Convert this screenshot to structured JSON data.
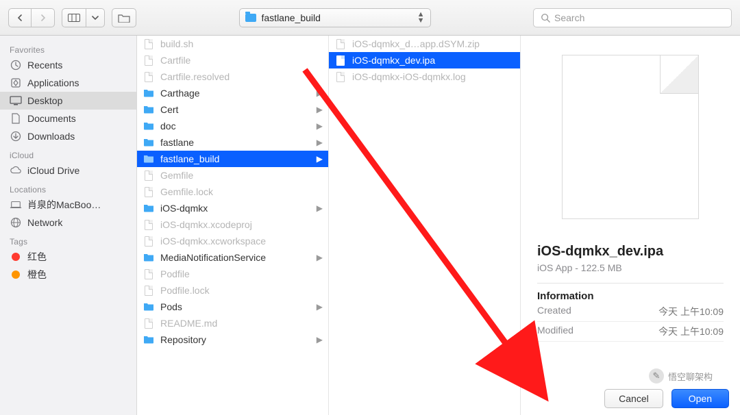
{
  "toolbar": {
    "current_folder": "fastlane_build",
    "search_placeholder": "Search"
  },
  "sidebar": {
    "sections": [
      {
        "title": "Favorites",
        "items": [
          {
            "label": "Recents",
            "icon": "clock"
          },
          {
            "label": "Applications",
            "icon": "app"
          },
          {
            "label": "Desktop",
            "icon": "desktop",
            "selected": true
          },
          {
            "label": "Documents",
            "icon": "doc"
          },
          {
            "label": "Downloads",
            "icon": "download"
          }
        ]
      },
      {
        "title": "iCloud",
        "items": [
          {
            "label": "iCloud Drive",
            "icon": "cloud"
          }
        ]
      },
      {
        "title": "Locations",
        "items": [
          {
            "label": "肖泉的MacBoo…",
            "icon": "laptop"
          },
          {
            "label": "Network",
            "icon": "globe"
          }
        ]
      },
      {
        "title": "Tags",
        "items": [
          {
            "label": "红色",
            "color": "#ff3b30"
          },
          {
            "label": "橙色",
            "color": "#ff9500"
          }
        ]
      }
    ]
  },
  "col1": [
    {
      "name": "build.sh",
      "type": "file",
      "dim": true
    },
    {
      "name": "Cartfile",
      "type": "file",
      "dim": true
    },
    {
      "name": "Cartfile.resolved",
      "type": "file",
      "dim": true
    },
    {
      "name": "Carthage",
      "type": "folder",
      "dim": false
    },
    {
      "name": "Cert",
      "type": "folder",
      "dim": false
    },
    {
      "name": "doc",
      "type": "folder",
      "dim": false
    },
    {
      "name": "fastlane",
      "type": "folder",
      "dim": false
    },
    {
      "name": "fastlane_build",
      "type": "folder",
      "dim": false,
      "selected": true
    },
    {
      "name": "Gemfile",
      "type": "file",
      "dim": true
    },
    {
      "name": "Gemfile.lock",
      "type": "file",
      "dim": true
    },
    {
      "name": "iOS-dqmkx",
      "type": "folder",
      "dim": false
    },
    {
      "name": "iOS-dqmkx.xcodeproj",
      "type": "file",
      "dim": true
    },
    {
      "name": "iOS-dqmkx.xcworkspace",
      "type": "file",
      "dim": true
    },
    {
      "name": "MediaNotificationService",
      "type": "folder",
      "dim": false
    },
    {
      "name": "Podfile",
      "type": "file",
      "dim": true
    },
    {
      "name": "Podfile.lock",
      "type": "file",
      "dim": true
    },
    {
      "name": "Pods",
      "type": "folder",
      "dim": false
    },
    {
      "name": "README.md",
      "type": "file",
      "dim": true
    },
    {
      "name": "Repository",
      "type": "folder",
      "dim": false
    }
  ],
  "col2": [
    {
      "name": "iOS-dqmkx_d…app.dSYM.zip",
      "type": "file",
      "dim": true
    },
    {
      "name": "iOS-dqmkx_dev.ipa",
      "type": "file",
      "dim": false,
      "selected": true
    },
    {
      "name": "iOS-dqmkx-iOS-dqmkx.log",
      "type": "file",
      "dim": true
    }
  ],
  "preview": {
    "title": "iOS-dqmkx_dev.ipa",
    "subtitle": "iOS App - 122.5 MB",
    "section": "Information",
    "rows": [
      {
        "k": "Created",
        "v": "今天 上午10:09"
      },
      {
        "k": "Modified",
        "v": "今天 上午10:09"
      }
    ]
  },
  "footer": {
    "cancel": "Cancel",
    "open": "Open"
  },
  "watermark": "悟空聊架构"
}
